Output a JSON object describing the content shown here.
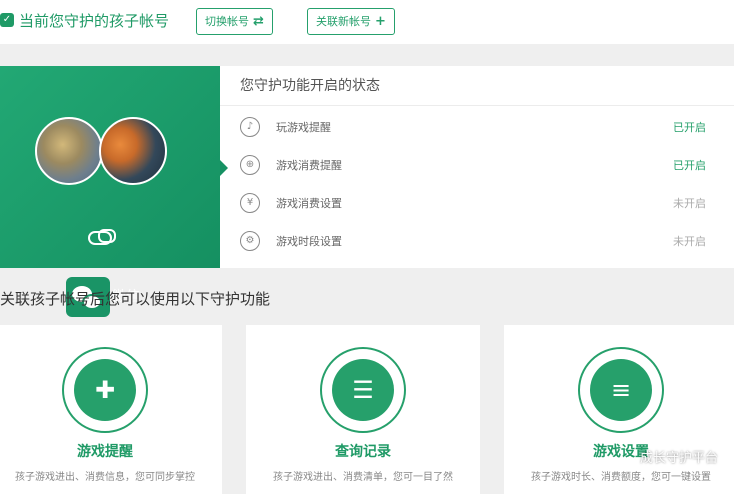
{
  "header": {
    "title": "当前您守护的孩子帐号",
    "switch_button": "切换帐号",
    "add_button": "关联新帐号"
  },
  "profile": {
    "account_type": "微信"
  },
  "status": {
    "header": "您守护功能开启的状态",
    "items": [
      {
        "label": "玩游戏提醒",
        "value": "已开启",
        "icon": "bell-icon"
      },
      {
        "label": "游戏消费提醒",
        "value": "已开启",
        "icon": "gamepad-icon"
      },
      {
        "label": "游戏消费设置",
        "value": "未开启",
        "icon": "yuan-icon"
      },
      {
        "label": "游戏时段设置",
        "value": "未开启",
        "icon": "gear-icon"
      }
    ]
  },
  "features": {
    "title": "关联孩子帐号后您可以使用以下守护功能",
    "cards": [
      {
        "title": "游戏提醒",
        "desc": "孩子游戏进出、消费信息，您可同步掌控",
        "icon": "gamepad-icon"
      },
      {
        "title": "查询记录",
        "desc": "孩子游戏进出、消费清单，您可一目了然",
        "icon": "document-search-icon"
      },
      {
        "title": "游戏设置",
        "desc": "孩子游戏时长、消费额度，您可一键设置",
        "icon": "sliders-icon"
      }
    ]
  },
  "watermark": "成长守护平台",
  "colors": {
    "brand_green": "#1f9a66",
    "status_on": "#26a06b",
    "status_off": "#aaaaaa"
  }
}
